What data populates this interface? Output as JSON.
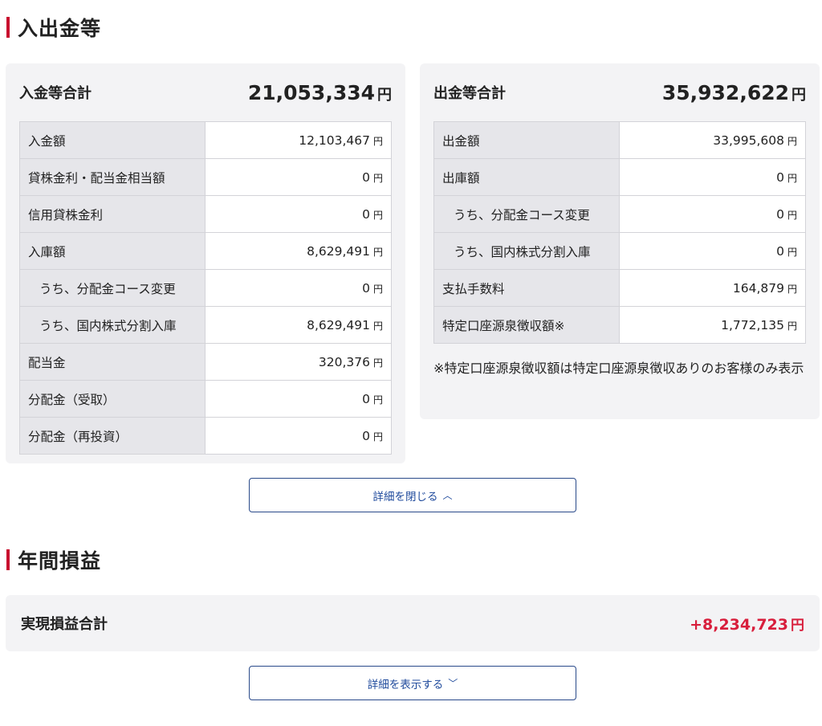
{
  "deposits_section": {
    "title": "入出金等"
  },
  "deposit_panel": {
    "label": "入金等合計",
    "total": "21,053,334",
    "rows": [
      {
        "label": "入金額",
        "value": "12,103,467",
        "sub": false
      },
      {
        "label": "貸株金利・配当金相当額",
        "value": "0",
        "sub": false
      },
      {
        "label": "信用貸株金利",
        "value": "0",
        "sub": false
      },
      {
        "label": "入庫額",
        "value": "8,629,491",
        "sub": false
      },
      {
        "label": "うち、分配金コース変更",
        "value": "0",
        "sub": true
      },
      {
        "label": "うち、国内株式分割入庫",
        "value": "8,629,491",
        "sub": true
      },
      {
        "label": "配当金",
        "value": "320,376",
        "sub": false
      },
      {
        "label": "分配金（受取）",
        "value": "0",
        "sub": false
      },
      {
        "label": "分配金（再投資）",
        "value": "0",
        "sub": false
      }
    ]
  },
  "withdraw_panel": {
    "label": "出金等合計",
    "total": "35,932,622",
    "rows": [
      {
        "label": "出金額",
        "value": "33,995,608",
        "sub": false
      },
      {
        "label": "出庫額",
        "value": "0",
        "sub": false
      },
      {
        "label": "うち、分配金コース変更",
        "value": "0",
        "sub": true
      },
      {
        "label": "うち、国内株式分割入庫",
        "value": "0",
        "sub": true
      },
      {
        "label": "支払手数料",
        "value": "164,879",
        "sub": false
      },
      {
        "label": "特定口座源泉徴収額※",
        "value": "1,772,135",
        "sub": false
      }
    ],
    "note": "※特定口座源泉徴収額は特定口座源泉徴収ありのお客様のみ表示"
  },
  "yen_unit": "円",
  "close_details_button": {
    "label": "詳細を閉じる",
    "chevron": "︿"
  },
  "annual_section": {
    "title": "年間損益"
  },
  "realized_panel": {
    "label": "実現損益合計",
    "total": "+8,234,723"
  },
  "show_details_button": {
    "label": "詳細を表示する",
    "chevron": "﹀"
  },
  "colors": {
    "accent_red": "#c8102e",
    "gain_red": "#d81e3c",
    "button_blue": "#1f4a9c"
  }
}
